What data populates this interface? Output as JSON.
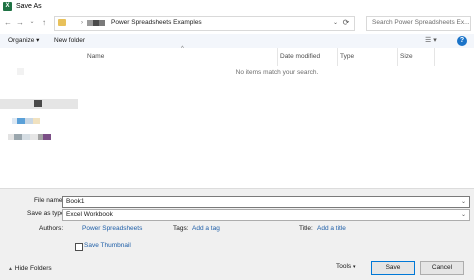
{
  "window": {
    "title": "Save As",
    "app_icon": "excel-icon"
  },
  "nav": {
    "back": "←",
    "forward": "→",
    "dropdown": "⌄",
    "up": "↑"
  },
  "address": {
    "separator": "›",
    "path": "Power Spreadsheets Examples",
    "dropdown": "⌄",
    "refresh": "⟳"
  },
  "search": {
    "placeholder": "Search Power Spreadsheets Ex..."
  },
  "toolbar": {
    "organize": "Organize ▾",
    "new_folder": "New folder",
    "view": "☰ ▾",
    "help": "?"
  },
  "file_list": {
    "columns": [
      "Name",
      "Date modified",
      "Type",
      "Size"
    ],
    "empty_message": "No items match your search.",
    "sort_indicator": "^"
  },
  "form": {
    "file_name_label": "File name:",
    "file_name_value": "Book1",
    "save_type_label": "Save as type:",
    "save_type_value": "Excel Workbook",
    "dropdown": "⌄",
    "authors_label": "Authors:",
    "authors_value": "Power Spreadsheets",
    "tags_label": "Tags:",
    "tags_value": "Add a tag",
    "title_label": "Title:",
    "title_value": "Add a title",
    "thumbnail_label": "Save Thumbnail"
  },
  "footer": {
    "hide_folders": "Hide Folders",
    "hide_icon": "▲",
    "tools": "Tools",
    "tools_arrow": "▾",
    "save": "Save",
    "cancel": "Cancel"
  },
  "colors": {
    "accent": "#0078d7",
    "link": "#1f5fa8",
    "excel_green": "#1f7244",
    "folder": "#e8c15b"
  }
}
